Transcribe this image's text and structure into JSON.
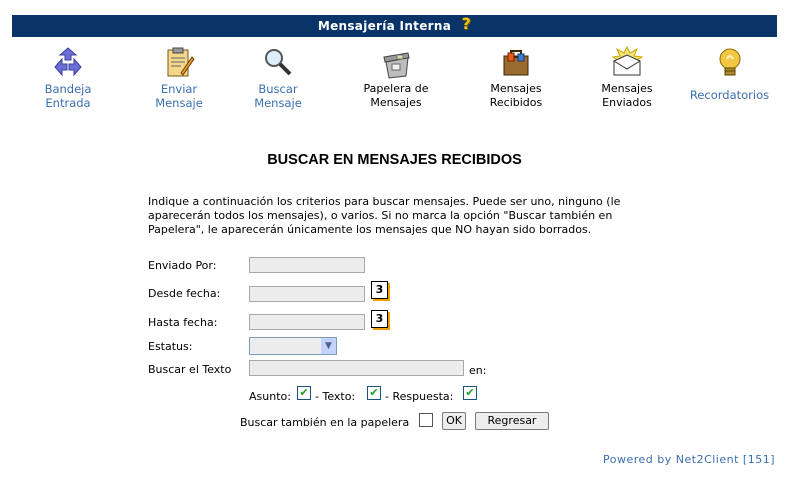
{
  "header": {
    "title": "Mensajería Interna",
    "help_icon": "help-question-icon"
  },
  "nav": [
    {
      "id": "bandeja",
      "line1": "Bandeja",
      "line2": "Entrada",
      "icon": "recycle-arrows-icon"
    },
    {
      "id": "enviar",
      "line1": "Enviar",
      "line2": "Mensaje",
      "icon": "clipboard-pencil-icon"
    },
    {
      "id": "buscar",
      "line1": "Buscar",
      "line2": "Mensaje",
      "icon": "magnifier-icon"
    },
    {
      "id": "papelera",
      "line1": "Papelera de",
      "line2": "Mensajes",
      "icon": "trash-bin-icon"
    },
    {
      "id": "recibidos",
      "line1": "Mensajes",
      "line2": "Recibidos",
      "icon": "briefcase-icon"
    },
    {
      "id": "enviados",
      "line1": "Mensajes",
      "line2": "Enviados",
      "icon": "envelope-icon"
    },
    {
      "id": "recordatorios",
      "line1": "Recordatorios",
      "line2": "",
      "icon": "lightbulb-icon"
    }
  ],
  "page_title": "BUSCAR EN MENSAJES RECIBIDOS",
  "intro": "Indique a continuación los criterios para buscar mensajes. Puede ser uno, ninguno (le aparecerán todos los mensajes), o varios. Si no marca la opción \"Buscar también en Papelera\", le aparecerán únicamente los mensajes que NO hayan sido borrados.",
  "form": {
    "enviado_por": "Enviado Por:",
    "desde_fecha": "Desde fecha:",
    "hasta_fecha": "Hasta fecha:",
    "calendar_label": "3",
    "estatus": "Estatus:",
    "buscar_texto": "Buscar el Texto",
    "en": "en:",
    "asunto": "Asunto:",
    "texto": "- Texto:",
    "respuesta": "- Respuesta:",
    "papelera": "Buscar también en la papelera",
    "check_mark": "✔",
    "ok": "OK",
    "regresar": "Regresar"
  },
  "footer": "Powered by Net2Client [151]"
}
